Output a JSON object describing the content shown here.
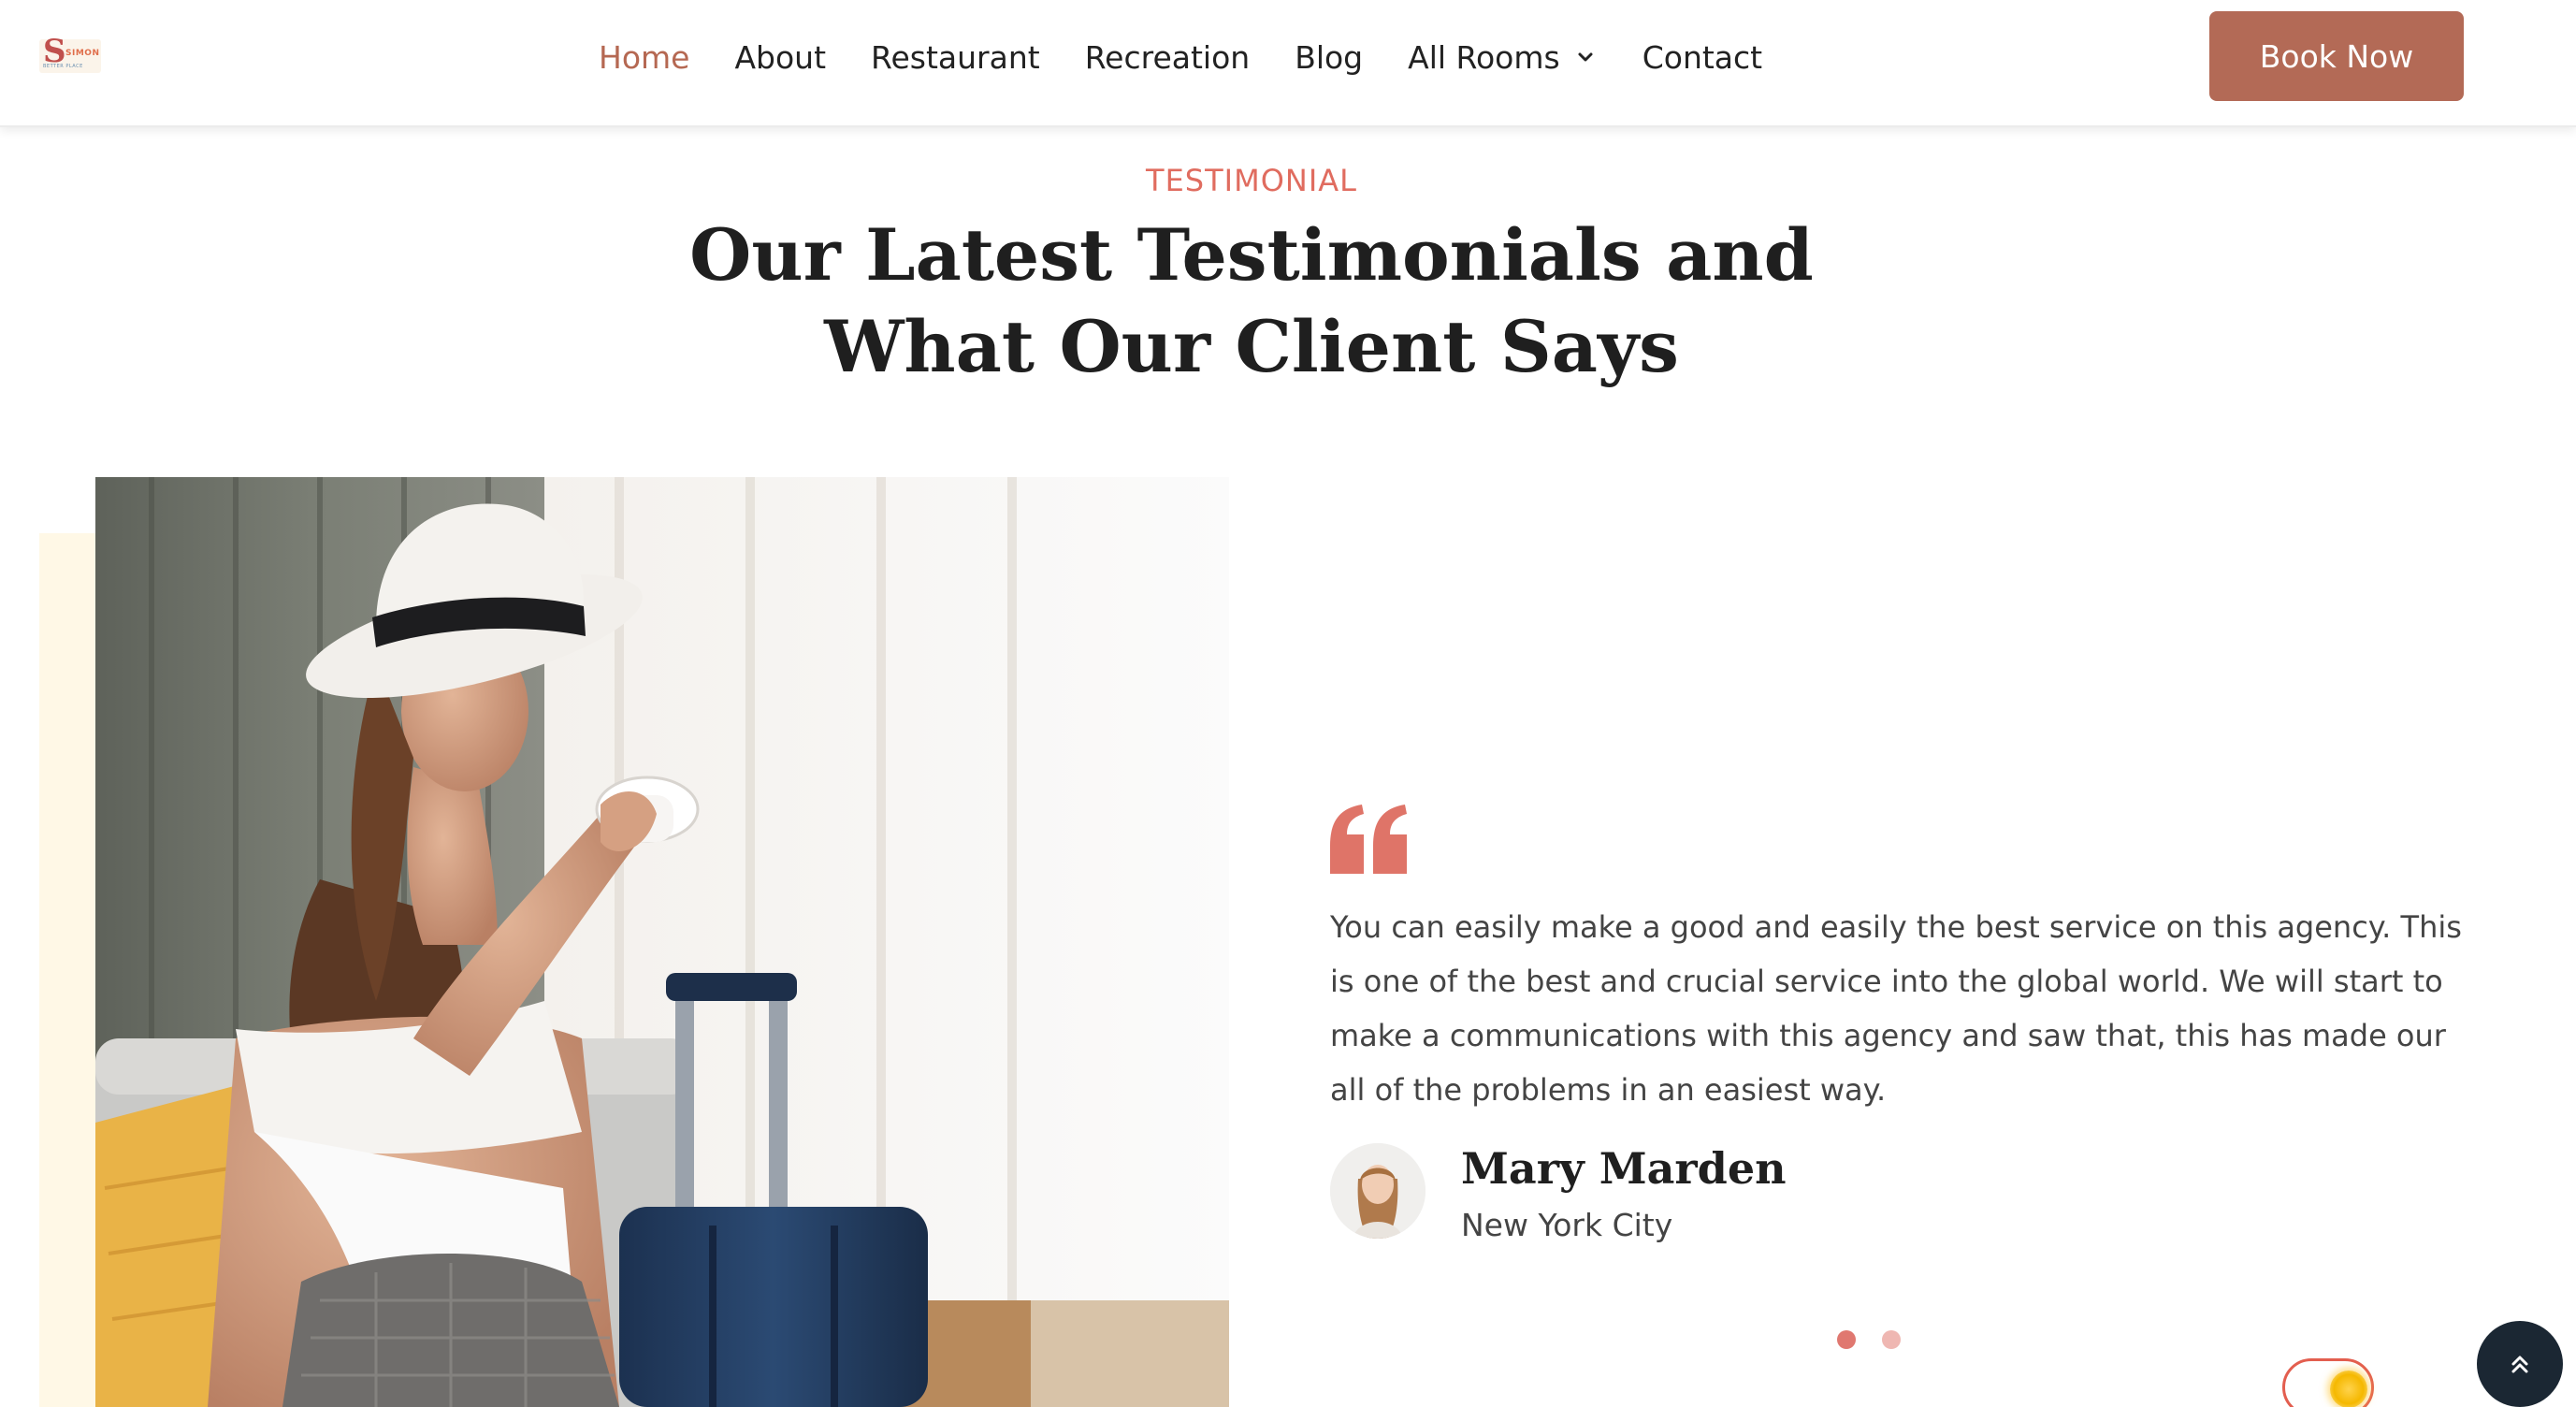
{
  "header": {
    "logo": {
      "letter": "S",
      "word": "SIMON",
      "tagline": "BETTER PLACE"
    },
    "nav": [
      {
        "label": "Home",
        "active": true
      },
      {
        "label": "About",
        "active": false
      },
      {
        "label": "Restaurant",
        "active": false
      },
      {
        "label": "Recreation",
        "active": false
      },
      {
        "label": "Blog",
        "active": false
      },
      {
        "label": "All Rooms",
        "active": false,
        "dropdown": true
      },
      {
        "label": "Contact",
        "active": false
      }
    ],
    "book_button": "Book Now"
  },
  "section": {
    "eyebrow": "TESTIMONIAL",
    "title_line1": "Our Latest Testimonials and",
    "title_line2": "What Our Client Says"
  },
  "testimonial": {
    "quote": "You can easily make a good and easily the best service on this agency. This is one of the best and crucial service into the global world. We will start to make a communications with this agency and saw that, this has made our all of the problems in an easiest way.",
    "author_name": "Mary Marden",
    "author_location": "New York City",
    "slides": 2,
    "active_slide": 1
  },
  "widgets": {
    "theme_toggle_icon": "sun-icon",
    "scroll_top_icon": "double-chevron-up-icon"
  },
  "colors": {
    "accent": "#b36a56",
    "eyebrow": "#e06c5f",
    "dot_active": "#e07870",
    "dot_inactive": "#efb7b2",
    "scroll_button": "#1b2733"
  }
}
